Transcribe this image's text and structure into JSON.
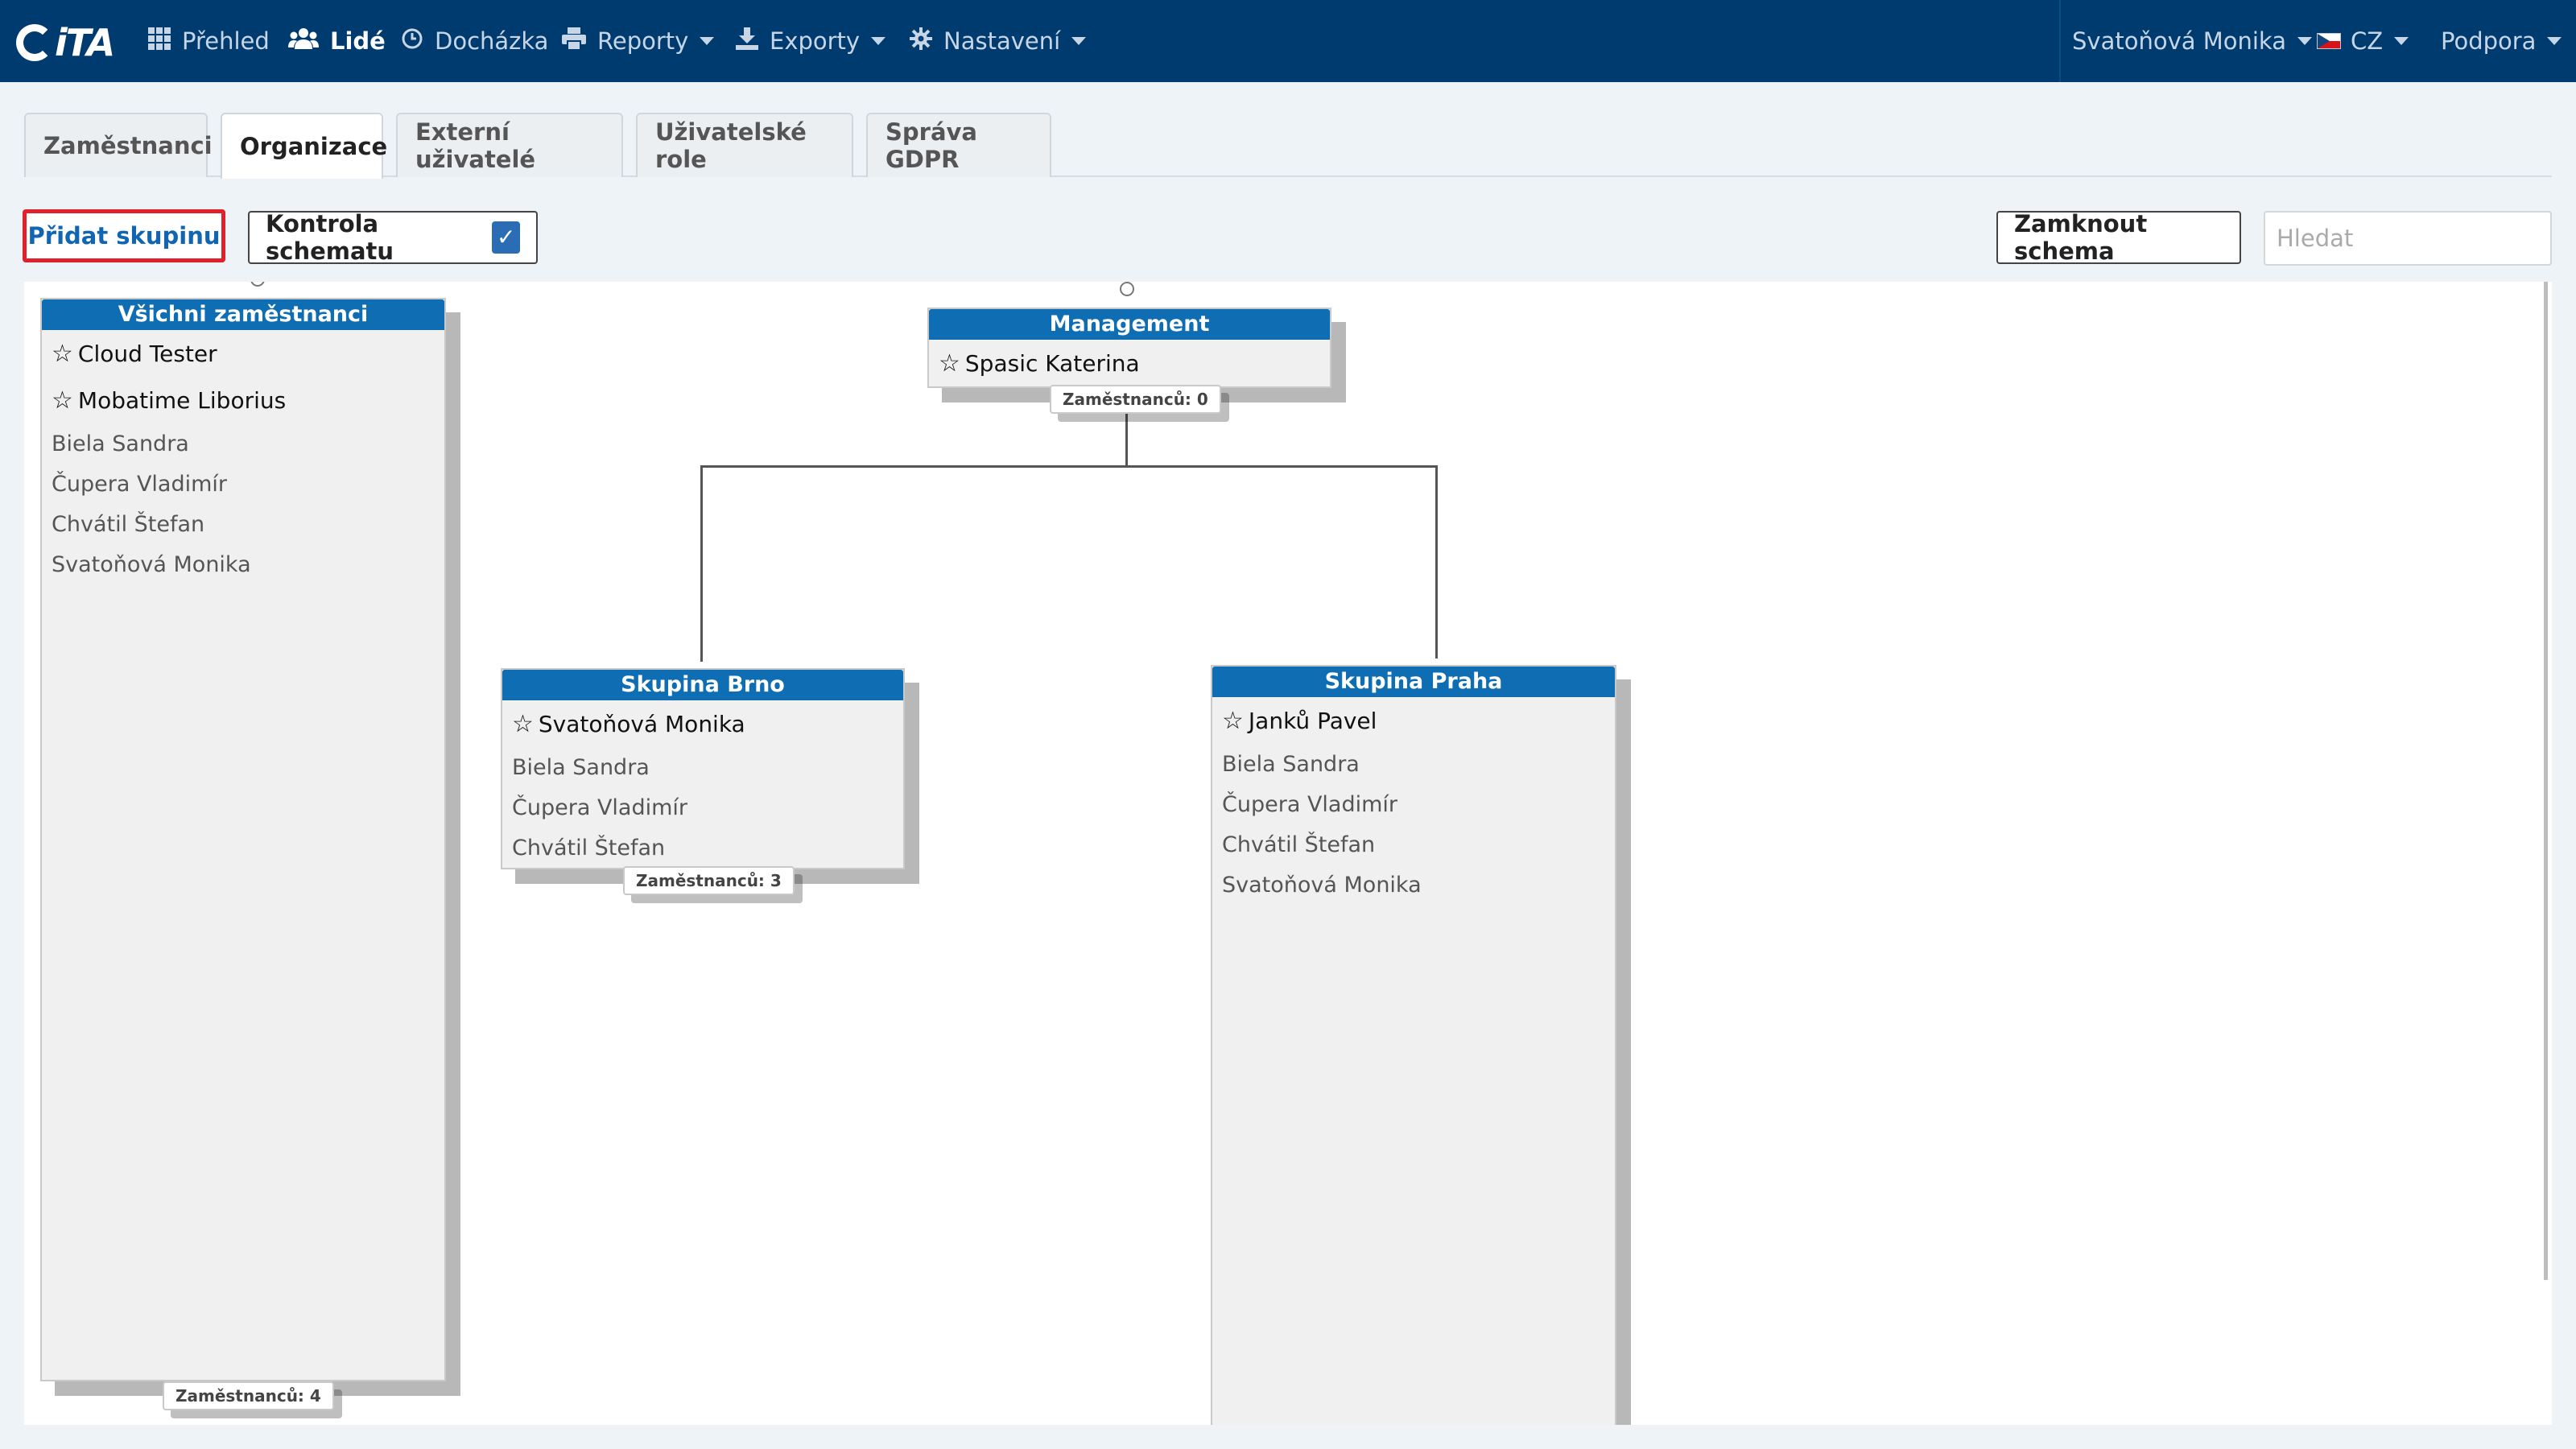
{
  "brand": {
    "name": "iTA"
  },
  "nav": {
    "items": [
      {
        "label": "Přehled",
        "icon": "grid-icon"
      },
      {
        "label": "Lidé",
        "icon": "users-icon",
        "active": true
      },
      {
        "label": "Docházka",
        "icon": "clock-icon"
      },
      {
        "label": "Reporty",
        "icon": "print-icon",
        "dropdown": true
      },
      {
        "label": "Exporty",
        "icon": "export-icon",
        "dropdown": true
      },
      {
        "label": "Nastavení",
        "icon": "gear-icon",
        "dropdown": true
      }
    ],
    "user": "Svatoňová Monika",
    "language": "CZ",
    "support": "Podpora"
  },
  "tabs": [
    {
      "label": "Zaměstnanci"
    },
    {
      "label": "Organizace",
      "active": true
    },
    {
      "label": "Externí uživatelé"
    },
    {
      "label": "Uživatelské role"
    },
    {
      "label": "Správa GDPR"
    }
  ],
  "toolbar": {
    "add_group": "Přidat skupinu",
    "schema_check": "Kontrola schematu",
    "schema_check_checked": true,
    "lock_schema": "Zamknout schema",
    "search_placeholder": "Hledat"
  },
  "groups": {
    "all": {
      "title": "Všichni zaměstnanci",
      "managers": [
        "Cloud Tester",
        "Mobatime Liborius"
      ],
      "members": [
        "Biela Sandra",
        "Čupera Vladimír",
        "Chvátil Štefan",
        "Svatoňová Monika"
      ],
      "count": "Zaměstnanců: 4"
    },
    "management": {
      "title": "Management",
      "managers": [
        "Spasic Katerina"
      ],
      "count": "Zaměstnanců: 0"
    },
    "brno": {
      "title": "Skupina Brno",
      "managers": [
        "Svatoňová Monika"
      ],
      "members": [
        "Biela Sandra",
        "Čupera Vladimír",
        "Chvátil Štefan"
      ],
      "count": "Zaměstnanců: 3"
    },
    "praha": {
      "title": "Skupina Praha",
      "managers": [
        "Janků Pavel"
      ],
      "members": [
        "Biela Sandra",
        "Čupera Vladimír",
        "Chvátil Štefan",
        "Svatoňová Monika"
      ]
    }
  },
  "colors": {
    "navbar": "#003b6f",
    "group_header": "#0f6db3",
    "highlight_border": "#e0202a",
    "page_background": "#eef3f8"
  }
}
